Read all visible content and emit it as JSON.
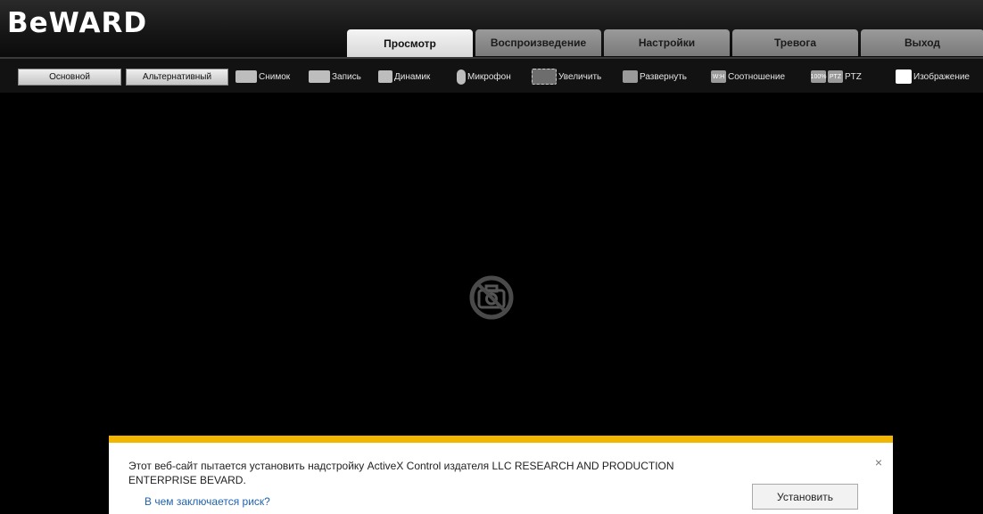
{
  "header": {
    "logo": "BeWARD",
    "tabs": [
      {
        "label": "Просмотр",
        "active": true
      },
      {
        "label": "Воспроизведение",
        "active": false
      },
      {
        "label": "Настройки",
        "active": false
      },
      {
        "label": "Тревога",
        "active": false
      },
      {
        "label": "Выход",
        "active": false
      }
    ]
  },
  "toolbar": {
    "stream_main": "Основной",
    "stream_alt": "Альтернативный",
    "snapshot": "Снимок",
    "record": "Запись",
    "speaker": "Динамик",
    "microphone": "Микрофон",
    "zoom": "Увеличить",
    "fullscreen": "Развернуть",
    "ratio": "Соотношение",
    "ratio_badge": "W:H",
    "hundred_badge": "100%",
    "ptz_badge": "PTZ",
    "ptz": "PTZ",
    "image": "Изображение"
  },
  "infobar": {
    "message": "Этот веб-сайт пытается установить надстройку ActiveX Control издателя LLC RESEARCH AND PRODUCTION ENTERPRISE BEVARD.",
    "risk_link": "В чем заключается риск?",
    "install_button": "Установить",
    "close": "×",
    "accent_color": "#f2b600"
  }
}
